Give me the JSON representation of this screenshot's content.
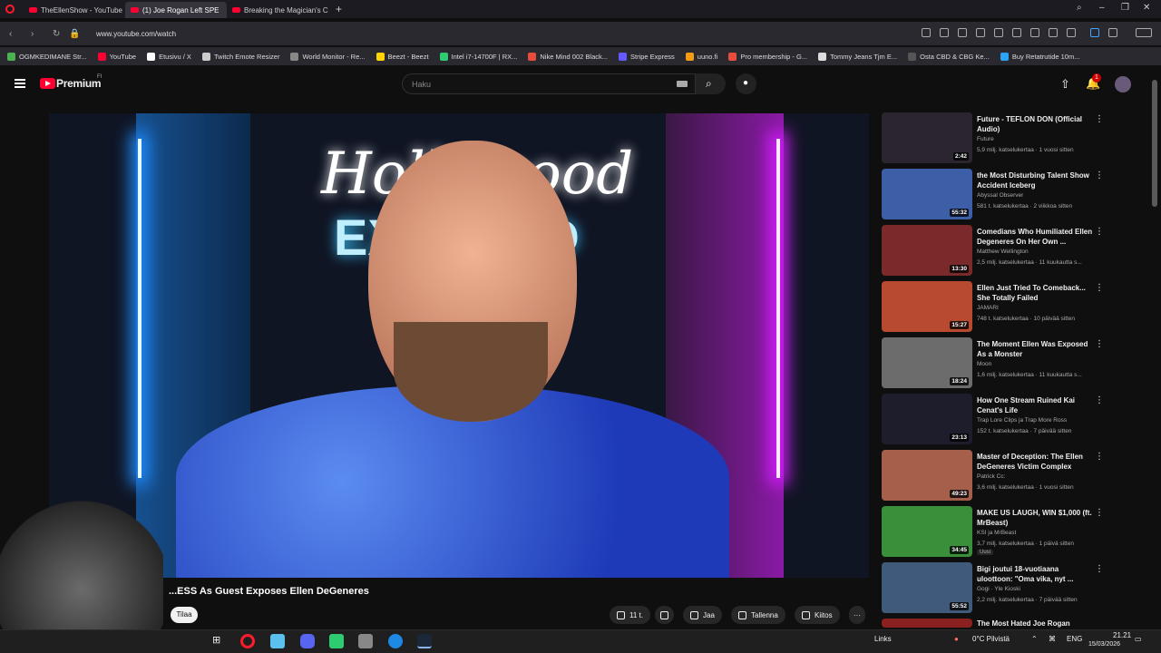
{
  "browser": {
    "tabs": [
      {
        "label": "TheEllenShow - YouTube",
        "active": false
      },
      {
        "label": "(1) Joe Rogan Left SPE",
        "active": true
      },
      {
        "label": "Breaking the Magician's C",
        "active": false
      }
    ],
    "url": "www.youtube.com/watch",
    "bookmarks": [
      {
        "label": "OGMKEDIMANE Str...",
        "color": "#4caf50"
      },
      {
        "label": "YouTube",
        "color": "#ff0033"
      },
      {
        "label": "Etusivu / X",
        "color": "#ffffff"
      },
      {
        "label": "Twitch Emote Resizer",
        "color": "#cccccc"
      },
      {
        "label": "World Monitor - Re...",
        "color": "#888888"
      },
      {
        "label": "Beezt - Beezt",
        "color": "#ffd400"
      },
      {
        "label": "Intel i7-14700F | RX...",
        "color": "#2ecc71"
      },
      {
        "label": "Nike Mind 002 Black...",
        "color": "#e74c3c"
      },
      {
        "label": "Stripe Express",
        "color": "#635bff"
      },
      {
        "label": "uuno.fi",
        "color": "#f39c12"
      },
      {
        "label": "Pro membership - G...",
        "color": "#e74c3c"
      },
      {
        "label": "Tommy Jeans Tjm E...",
        "color": "#dddddd"
      },
      {
        "label": "Osta CBD & CBG Ke...",
        "color": "#555555"
      },
      {
        "label": "Buy Retatrutide 10m...",
        "color": "#2aa4f4"
      }
    ]
  },
  "youtube": {
    "logo_text": "Premium",
    "region": "FI",
    "search_placeholder": "Haku",
    "notification_count": "1",
    "video_overlay": {
      "line1": "Hollywood",
      "line2": "EXPOSED"
    },
    "video_title": "...ESS As Guest Exposes Ellen DeGeneres",
    "subscribe_label": "Tilaa",
    "actions": {
      "likes": "11 t.",
      "share": "Jaa",
      "save": "Tallenna",
      "thanks": "Kiitos"
    },
    "recommendations": [
      {
        "title": "Future - TEFLON DON (Official Audio)",
        "channel": "Future",
        "meta": "5,9 milj. katselukertaa · 1 vuosi sitten",
        "duration": "2:42",
        "color": "#2b2530"
      },
      {
        "title": "the Most Disturbing Talent Show Accident Iceberg",
        "channel": "Abyssal Observer",
        "meta": "581 t. katselukertaa · 2 viikkoa sitten",
        "duration": "55:32",
        "color": "#3c5fa8"
      },
      {
        "title": "Comedians Who Humiliated Ellen Degeneres On Her Own ...",
        "channel": "Matthew Wellington",
        "meta": "2,5 milj. katselukertaa · 11 kuukautta s...",
        "duration": "13:30",
        "color": "#7a2a2a"
      },
      {
        "title": "Ellen Just Tried To Comeback... She Totally Failed",
        "channel": "JAMARI",
        "meta": "748 t. katselukertaa · 10 päivää sitten",
        "duration": "15:27",
        "color": "#b84b2f"
      },
      {
        "title": "The Moment Ellen Was Exposed As a Monster",
        "channel": "Moon",
        "meta": "1,6 milj. katselukertaa · 11 kuukautta s...",
        "duration": "18:24",
        "color": "#6c6c6c"
      },
      {
        "title": "How One Stream Ruined Kai Cenat's Life",
        "channel": "Trap Lore Clips ja Trap More Ross",
        "meta": "152 t. katselukertaa · 7 päivää sitten",
        "duration": "23:13",
        "color": "#1d1d2b"
      },
      {
        "title": "Master of Deception: The Ellen DeGeneres Victim Complex",
        "channel": "Patrick Cc:",
        "meta": "3,6 milj. katselukertaa · 1 vuosi sitten",
        "duration": "49:23",
        "color": "#a65f4a"
      },
      {
        "title": "MAKE US LAUGH, WIN $1,000 (ft. MrBeast)",
        "channel": "KSI ja MrBeast",
        "meta": "3,7 milj. katselukertaa · 1 päivä sitten",
        "duration": "34:45",
        "color": "#3a8f3a",
        "badge": "Uusi"
      },
      {
        "title": "Bigi joutui 18-vuotiaana uloottoon: \"Oma vika, nyt ...",
        "channel": "Gogi · Yle Kioski",
        "meta": "2,2 milj. katselukertaa · 7 päivää sitten",
        "duration": "55:52",
        "color": "#3f5a7a"
      },
      {
        "title": "The Most Hated Joe Rogan",
        "channel": "",
        "meta": "",
        "duration": "",
        "color": "#8a2020"
      }
    ]
  },
  "taskbar": {
    "links": "Links",
    "weather": "0°C  Pilvistä",
    "lang": "ENG",
    "time": "21.21",
    "date": "15/03/2026"
  }
}
